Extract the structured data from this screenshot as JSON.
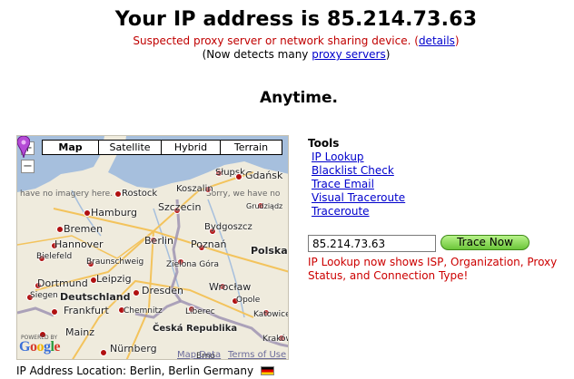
{
  "header": {
    "title": "Your IP address is 85.214.73.63",
    "proxy_notice": "Suspected proxy server or network sharing device. (",
    "proxy_link": "details",
    "proxy_close": ")",
    "detects_prefix": "(Now detects many ",
    "detects_link": "proxy servers",
    "detects_suffix": ")"
  },
  "tagline": "Anytime.",
  "map": {
    "zoom_in": "+",
    "zoom_out": "−",
    "types": [
      "Map",
      "Satellite",
      "Hybrid",
      "Terrain"
    ],
    "active_type": "Map",
    "no_imagery_left": "have no imagery here.",
    "no_imagery_right": "Sorry, we have no",
    "cities": [
      "Słupsk",
      "Gdańsk",
      "Rostock",
      "Koszalin",
      "Hamburg",
      "Szczecin",
      "Grudziądz",
      "Bremen",
      "Bydgoszcz",
      "Hannover",
      "Berlin",
      "Poznań",
      "Polska",
      "Bielefeld",
      "Braunschweig",
      "Zielona Góra",
      "Leipzig",
      "Wrocław",
      "Dortmund",
      "Siegen",
      "Deutschland",
      "Dresden",
      "Opole",
      "Frankfurt",
      "Chemnitz",
      "Liberec",
      "Katowice",
      "Česká Republika",
      "Mainz",
      "Nürnberg",
      "Brno",
      "Kraków"
    ],
    "powered_by": "POWERED BY",
    "logo": "Google",
    "map_data": "Map Data",
    "terms": "Terms of Use"
  },
  "location": {
    "text": "IP Address Location: Berlin, Berlin Germany",
    "flag_colors": [
      "#000000",
      "#dd0000",
      "#ffce00"
    ]
  },
  "tools": {
    "title": "Tools",
    "links": [
      "IP Lookup",
      "Blacklist Check",
      "Trace Email",
      "Visual Traceroute",
      "Traceroute"
    ]
  },
  "trace": {
    "input_value": "85.214.73.63",
    "button": "Trace Now",
    "notice": "IP Lookup now shows ISP, Organization, Proxy Status, and Connection Type!"
  },
  "colors": {
    "notice_red": "#cc0000",
    "link_blue": "#0000cc",
    "button_green": "#6cc53a",
    "map_land": "#efebdd",
    "map_sea": "#a6bfdd",
    "border_purple": "#9a8fb0"
  }
}
